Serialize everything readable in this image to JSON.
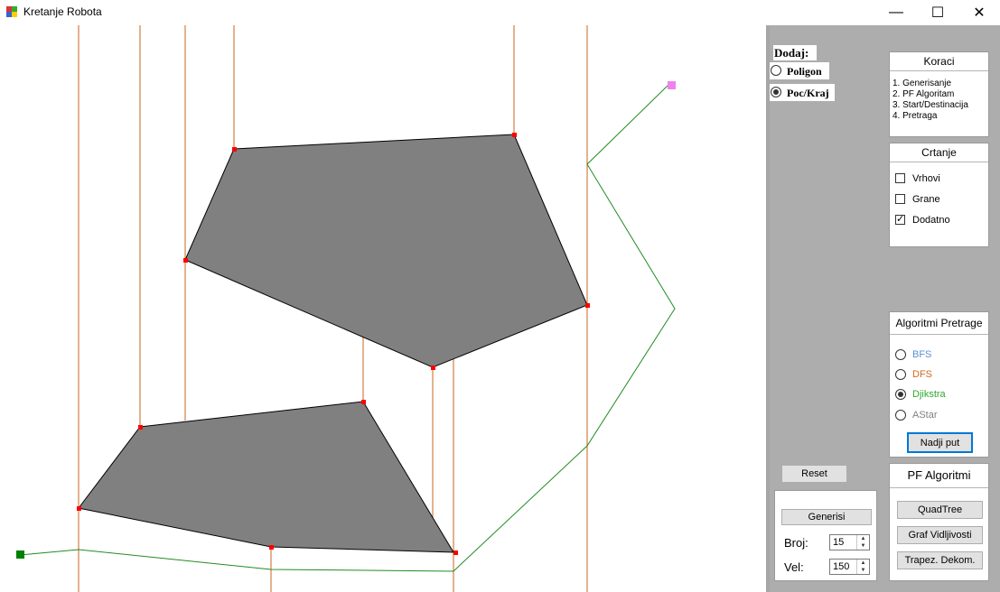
{
  "window": {
    "title": "Kretanje Robota",
    "minimize": "—",
    "maximize": "☐",
    "close": "✕"
  },
  "dodaj": {
    "title": "Dodaj:",
    "options": [
      "Poligon",
      "Poc/Kraj"
    ],
    "selected": 1
  },
  "koraci": {
    "title": "Koraci",
    "items": [
      "1. Generisanje",
      "2. PF Algoritam",
      "3. Start/Destinacija",
      "4. Pretraga"
    ]
  },
  "crtanje": {
    "title": "Crtanje",
    "items": [
      {
        "label": "Vrhovi",
        "checked": false
      },
      {
        "label": "Grane",
        "checked": false
      },
      {
        "label": "Dodatno",
        "checked": true
      }
    ]
  },
  "algoritmi": {
    "title": "Algoritmi Pretrage",
    "options": [
      {
        "label": "BFS",
        "color": "#5b8fd6"
      },
      {
        "label": "DFS",
        "color": "#d2691e"
      },
      {
        "label": "Djikstra",
        "color": "#2fa82f"
      },
      {
        "label": "AStar",
        "color": "#808080"
      }
    ],
    "selected": 2,
    "find_button": "Nadji put"
  },
  "reset_button": "Reset",
  "generator": {
    "generate_button": "Generisi",
    "broj_label": "Broj:",
    "broj_value": "15",
    "vel_label": "Vel:",
    "vel_value": "150"
  },
  "pf": {
    "title": "PF Algoritmi",
    "buttons": [
      "QuadTree",
      "Graf Vidljivosti",
      "Trapez. Dekom."
    ]
  },
  "colors": {
    "polygon_fill": "#808080",
    "vertex": "#ff0000",
    "decomposition_line": "#c8641e",
    "path_line": "#228b22",
    "start_marker": "#008000",
    "end_marker": "#ee82ee"
  }
}
